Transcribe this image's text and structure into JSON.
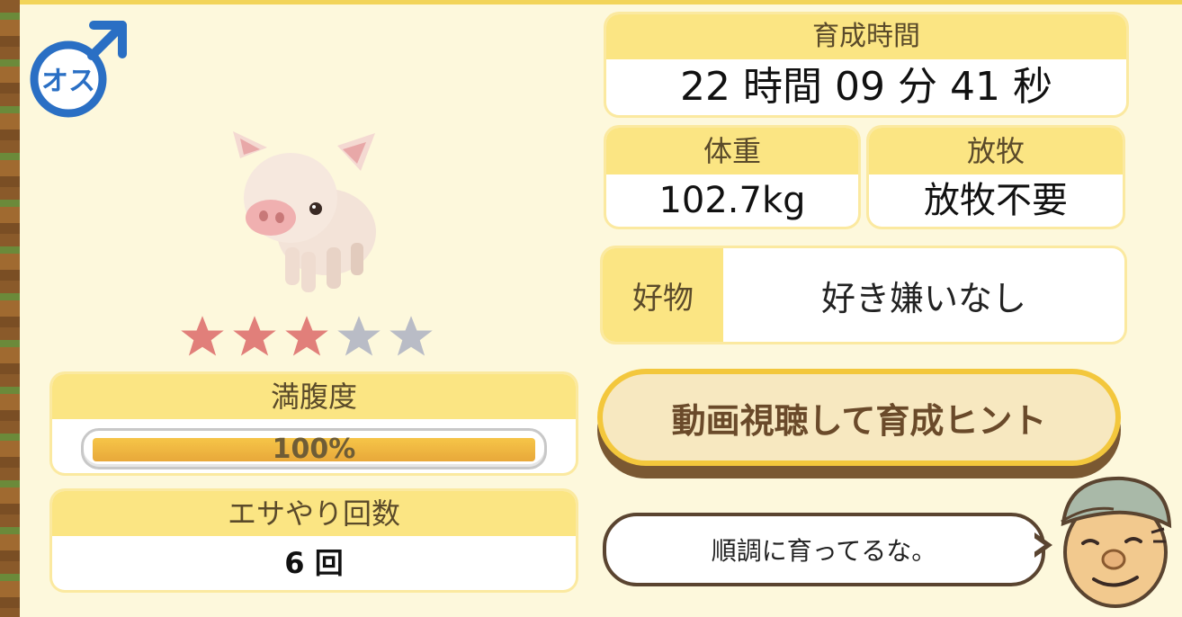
{
  "gender": {
    "label": "オス",
    "icon": "male-icon",
    "color": "#2a6fc4"
  },
  "pig": {
    "icon": "pig-icon"
  },
  "rating": {
    "filled": 3,
    "total": 5,
    "filled_color": "#e17f7a",
    "empty_color": "#b9bcc6"
  },
  "satiety": {
    "label": "満腹度",
    "value_text": "100%",
    "percent": 100
  },
  "feed_count": {
    "label": "エサやり回数",
    "value": "6 回"
  },
  "growth_time": {
    "label": "育成時間",
    "value": "22 時間 09 分 41 秒"
  },
  "weight": {
    "label": "体重",
    "value": "102.7kg"
  },
  "grazing": {
    "label": "放牧",
    "value": "放牧不要"
  },
  "preference": {
    "label": "好物",
    "value": "好き嫌いなし"
  },
  "hint_button": {
    "label": "動画視聴して育成ヒント"
  },
  "speech": {
    "text": "順調に育ってるな。"
  },
  "farmer": {
    "icon": "farmer-icon"
  },
  "colors": {
    "header_yellow": "#fbe583",
    "bar_fill": "#f0b640",
    "accent_border": "#f3c73c"
  }
}
